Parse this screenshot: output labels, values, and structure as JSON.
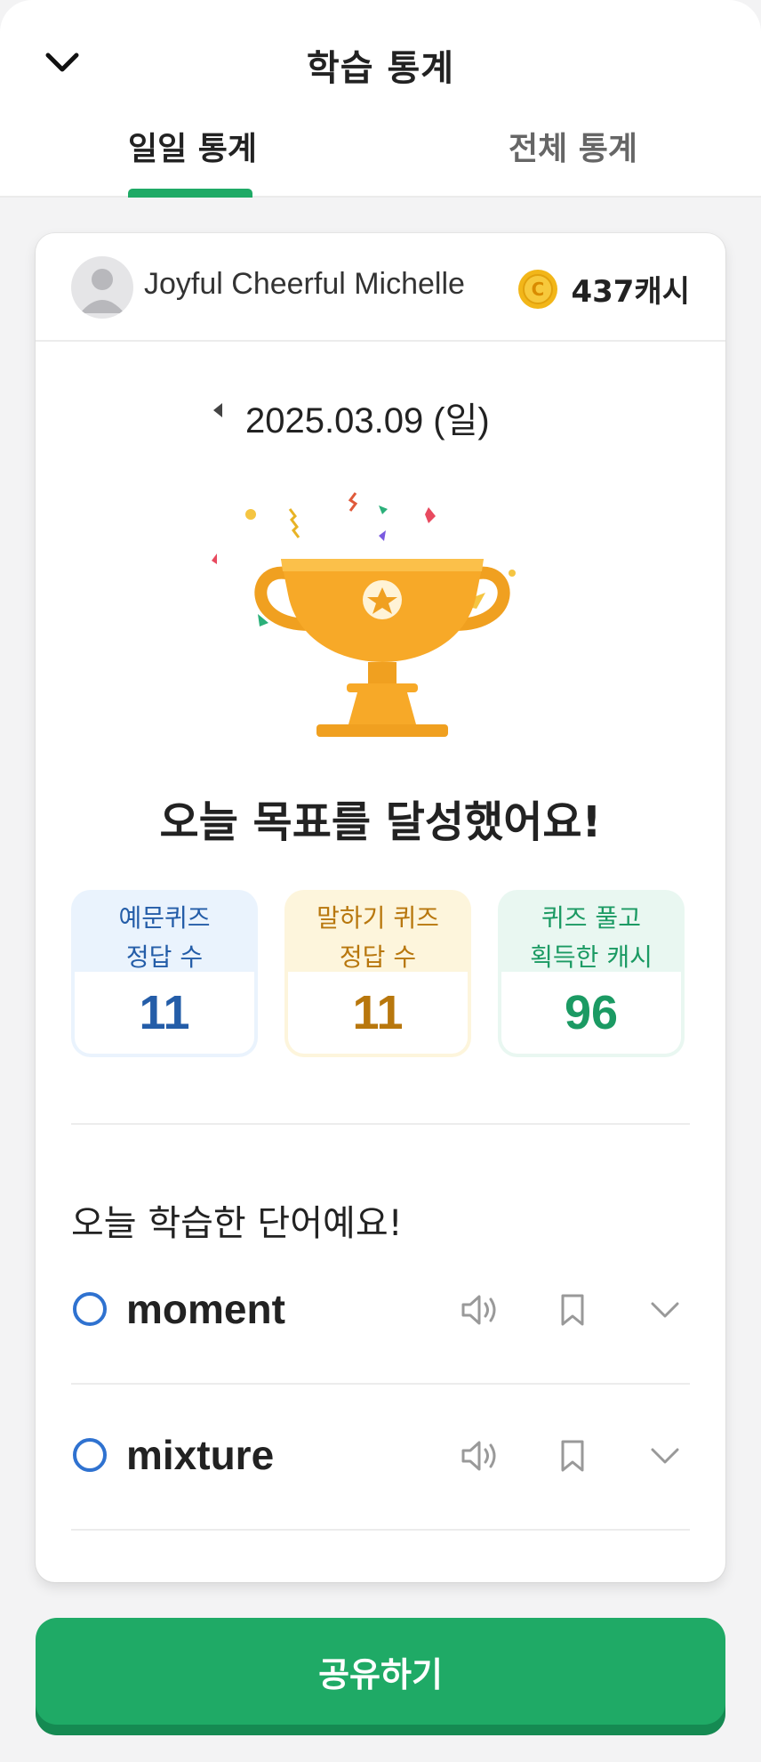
{
  "header": {
    "title": "학습 통계",
    "tabs": [
      {
        "label": "일일 통계",
        "active": true
      },
      {
        "label": "전체 통계",
        "active": false
      }
    ]
  },
  "user": {
    "name": "Joyful Cheerful Michelle",
    "cash": "437캐시"
  },
  "date": "2025.03.09 (일)",
  "headline": "오늘 목표를 달성했어요!",
  "stats": [
    {
      "label_line1": "예문퀴즈",
      "label_line2": "정답 수",
      "value": "11",
      "color": "#245da8"
    },
    {
      "label_line1": "말하기 퀴즈",
      "label_line2": "정답 수",
      "value": "11",
      "color": "#b8770d"
    },
    {
      "label_line1": "퀴즈 풀고",
      "label_line2": "획득한 캐시",
      "value": "96",
      "color": "#1b9a63"
    }
  ],
  "words_section": {
    "title": "오늘 학습한 단어예요!",
    "words": [
      {
        "word": "moment"
      },
      {
        "word": "mixture"
      }
    ]
  },
  "share_button": "공유하기",
  "colors": {
    "accent": "#1faa66",
    "word_status": "#2f72d0"
  }
}
